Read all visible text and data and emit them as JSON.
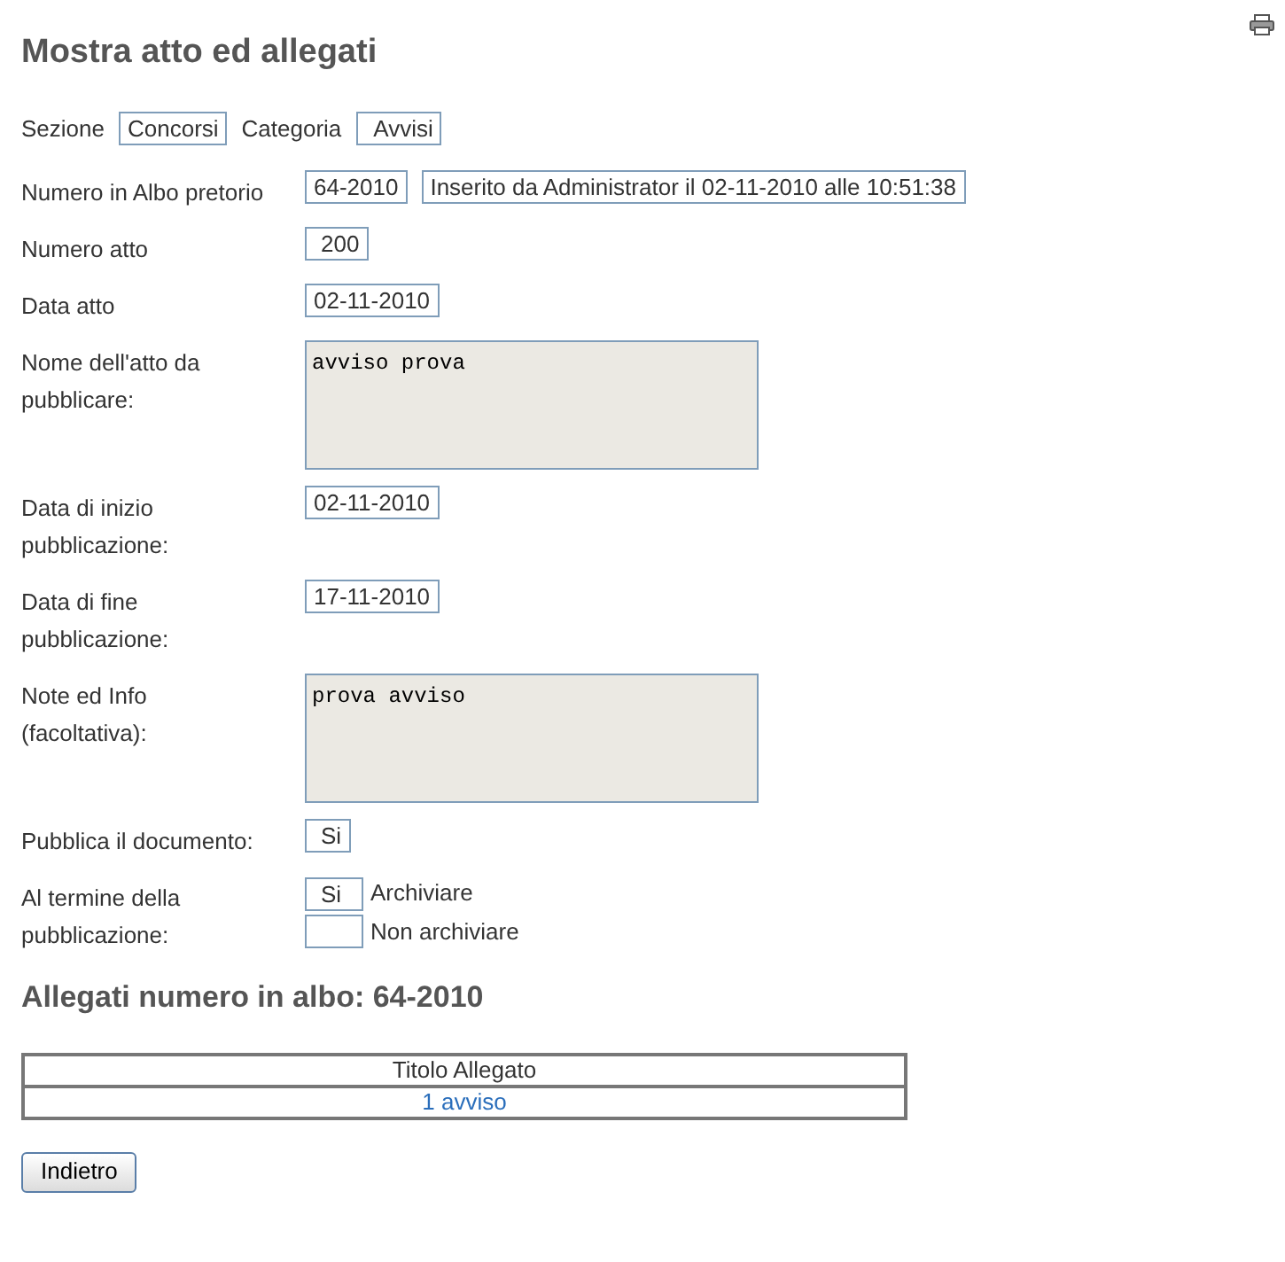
{
  "title": "Mostra atto ed allegati",
  "section": {
    "label": "Sezione",
    "value": "Concorsi"
  },
  "category": {
    "label": "Categoria",
    "value": "Avvisi"
  },
  "rows": [
    {
      "kind": "text",
      "label": "Numero in Albo pretorio",
      "values": [
        "64-2010",
        "Inserito da Administrator il 02-11-2010 alle 10:51:38"
      ]
    },
    {
      "kind": "text",
      "label": "Numero atto",
      "values": [
        "200"
      ]
    },
    {
      "kind": "text",
      "label": "Data atto",
      "values": [
        "02-11-2010"
      ]
    },
    {
      "kind": "textarea",
      "label": "Nome dell'atto da\npubblicare:",
      "values": [
        "avviso prova"
      ]
    },
    {
      "kind": "text",
      "label": "Data di inizio\npubblicazione:",
      "values": [
        "02-11-2010"
      ]
    },
    {
      "kind": "text",
      "label": "Data di fine\npubblicazione:",
      "values": [
        "17-11-2010"
      ]
    },
    {
      "kind": "textarea",
      "label": "Note ed Info\n(facoltativa):",
      "values": [
        "prova avviso"
      ]
    },
    {
      "kind": "text",
      "label": "Pubblica il documento:",
      "values": [
        "Si"
      ]
    },
    {
      "kind": "options",
      "label": "Al termine della\npubblicazione:",
      "options": [
        {
          "value": "Si",
          "label": "Archiviare"
        },
        {
          "label": "Non archiviare"
        }
      ]
    }
  ],
  "attachments": {
    "title": "Allegati numero in albo: 64-2010",
    "columns": [
      "Titolo Allegato"
    ],
    "rows": [
      [
        "1 avviso"
      ]
    ]
  },
  "buttons": [
    "Indietro"
  ]
}
